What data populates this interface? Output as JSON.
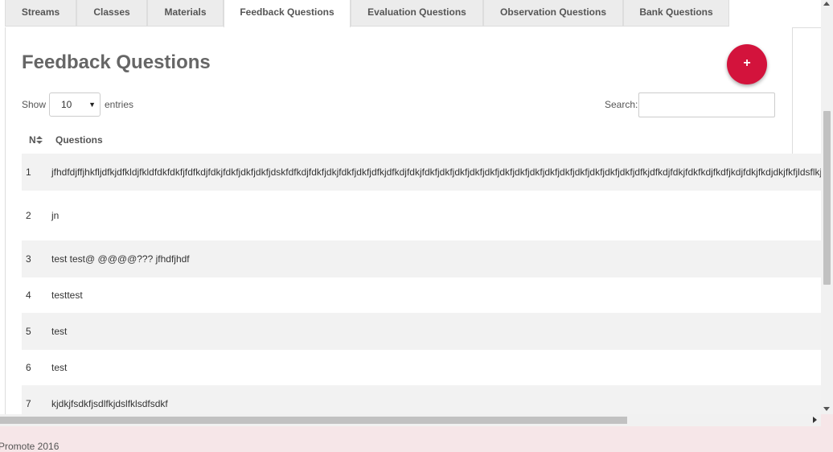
{
  "tabs": [
    {
      "label": "Streams",
      "active": false
    },
    {
      "label": "Classes",
      "active": false
    },
    {
      "label": "Materials",
      "active": false
    },
    {
      "label": "Feedback Questions",
      "active": true
    },
    {
      "label": "Evaluation Questions",
      "active": false
    },
    {
      "label": "Observation Questions",
      "active": false
    },
    {
      "label": "Bank Questions",
      "active": false
    }
  ],
  "page": {
    "title": "Feedback Questions",
    "add_button_label": "+"
  },
  "controls": {
    "show_label": "Show",
    "entries_value": "10",
    "entries_label": "entries",
    "search_label": "Search:",
    "search_value": ""
  },
  "table": {
    "columns": [
      "N",
      "Questions"
    ],
    "rows": [
      {
        "n": "1",
        "question": "jfhdfdjffjhkfljdfkjdfkldjfkldfdkfdkfjfdfkdjfdkjfdkfjdkfjdkfjdskfdfkdjfdkfjdkjfdkfjdkfjdfkjdfkdjfdkjfdkfjdkfjdkfjdkfjdkfjdkfjdkfjdkfjdkfjdkfjdkfjdkfjdkfjdkfjdfkjdfkdjfdkjfdkfkdjfkdfjkdjfdkjfkdjdkjfkfjldsflkjdfkjlsljkfskjsdkfjsdkfjsdk"
      },
      {
        "n": "2",
        "question": "jn"
      },
      {
        "n": "3",
        "question": "test test@ @@@@??? jfhdfjhdf"
      },
      {
        "n": "4",
        "question": "testtest"
      },
      {
        "n": "5",
        "question": "test"
      },
      {
        "n": "6",
        "question": "test"
      },
      {
        "n": "7",
        "question": "kjdkjfsdkfjsdlfkjdslfklsdfsdkf"
      }
    ]
  },
  "footer": {
    "text": "Promote 2016"
  },
  "colors": {
    "accent": "#d3133c",
    "footer_background": "#f6e6e8"
  }
}
